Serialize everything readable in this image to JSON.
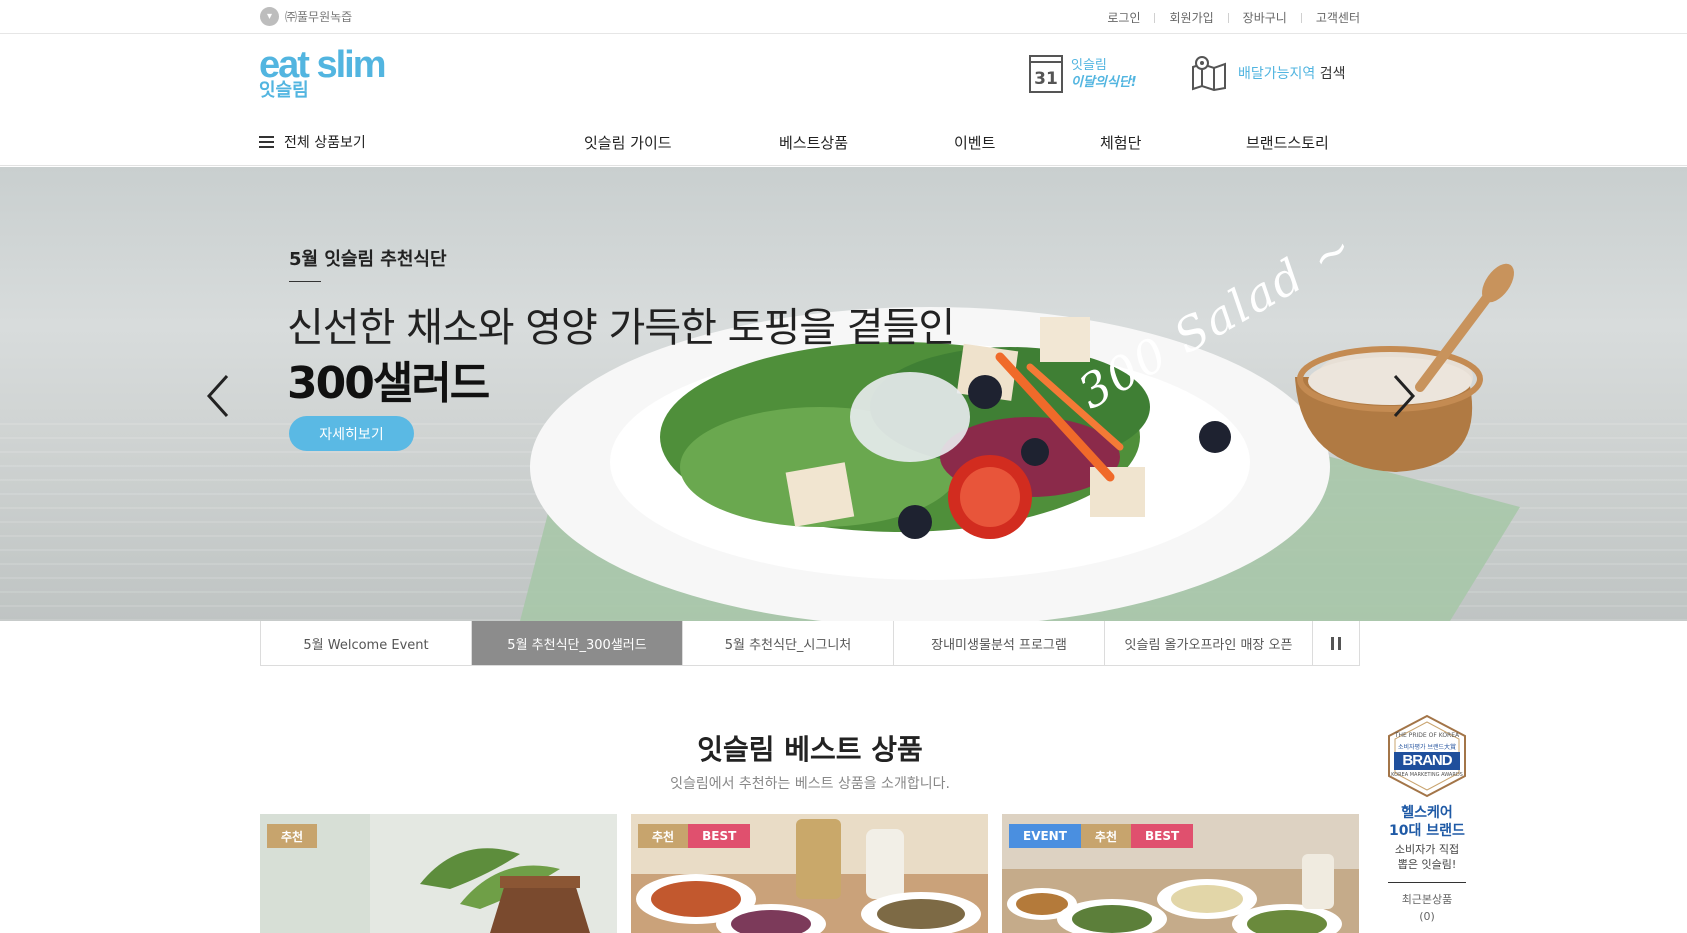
{
  "topbar": {
    "company": "㈜풀무원녹즙",
    "links": [
      "로그인",
      "회원가입",
      "장바구니",
      "고객센터"
    ]
  },
  "header": {
    "logo_en": "eat slim",
    "logo_ko": "잇슬림",
    "calendar_day": "31",
    "calendar_line1": "잇슬림",
    "calendar_line2": "이달의식단!",
    "delivery_highlight": "배달가능지역",
    "delivery_rest": " 검색"
  },
  "gnb": {
    "all_menu": "전체 상품보기",
    "items": [
      "잇슬림 가이드",
      "베스트상품",
      "이벤트",
      "체험단",
      "브랜드스토리"
    ]
  },
  "hero": {
    "eyebrow": "5월 잇슬림 추천식단",
    "line": "신선한 채소와 영양 가득한 토핑을 곁들인",
    "title": "300샐러드",
    "button": "자세히보기",
    "script": "300 Salad ~"
  },
  "tabs": [
    "5월 Welcome Event",
    "5월 추천식단_300샐러드",
    "5월 추천식단_시그니처",
    "장내미생물분석 프로그램",
    "잇슬림 올가오프라인 매장 오픈"
  ],
  "best": {
    "title": "잇슬림 베스트 상품",
    "subtitle": "잇슬림에서 추천하는 베스트 상품을 소개합니다.",
    "cards": [
      {
        "badges": [
          "추천"
        ]
      },
      {
        "badges": [
          "추천",
          "BEST"
        ]
      },
      {
        "badges": [
          "EVENT",
          "추천",
          "BEST"
        ]
      }
    ]
  },
  "side": {
    "emblem_top": "THE PRIDE OF KOREA",
    "emblem_mid": "소비자평가 브랜드大賞",
    "emblem_brand": "BRAND",
    "emblem_bottom": "KOREA MARKETING AWARDS",
    "title1": "헬스케어",
    "title2": "10대 브랜드",
    "desc1": "소비자가 직접",
    "desc2": "뽑은 잇슬림!",
    "recent_label": "최근본상품",
    "recent_count": "(0)"
  },
  "colors": {
    "brand_blue": "#52b5e0",
    "badge_recommend": "#c7a46d",
    "badge_best": "#e0506e",
    "badge_event": "#4a8fe0",
    "tab_active": "#8c8c8c"
  }
}
